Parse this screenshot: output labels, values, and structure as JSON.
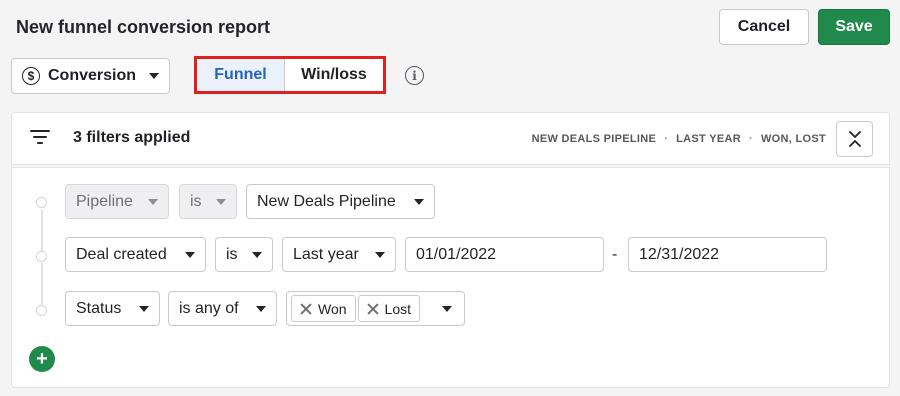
{
  "header": {
    "title": "New funnel conversion report",
    "cancel_label": "Cancel",
    "save_label": "Save"
  },
  "report_type": {
    "selected": "Conversion",
    "icon": "dollar-circle-icon"
  },
  "view_toggle": {
    "options": [
      "Funnel",
      "Win/loss"
    ],
    "active": "Funnel"
  },
  "filters": {
    "count_label": "3 filters applied",
    "summary": [
      "NEW DEALS PIPELINE",
      "LAST YEAR",
      "WON, LOST"
    ],
    "separator": "·",
    "rows": [
      {
        "field": "Pipeline",
        "operator": "is",
        "value": "New Deals Pipeline"
      },
      {
        "field": "Deal created",
        "operator": "is",
        "value": "Last year",
        "date_from": "01/01/2022",
        "date_sep": "-",
        "date_to": "12/31/2022"
      },
      {
        "field": "Status",
        "operator": "is any of",
        "chips": [
          "Won",
          "Lost"
        ]
      }
    ],
    "add_label": "+"
  },
  "colors": {
    "save_green": "#1f8a4c",
    "active_tab_blue": "#2664b8",
    "highlight_red": "#e0201c"
  }
}
